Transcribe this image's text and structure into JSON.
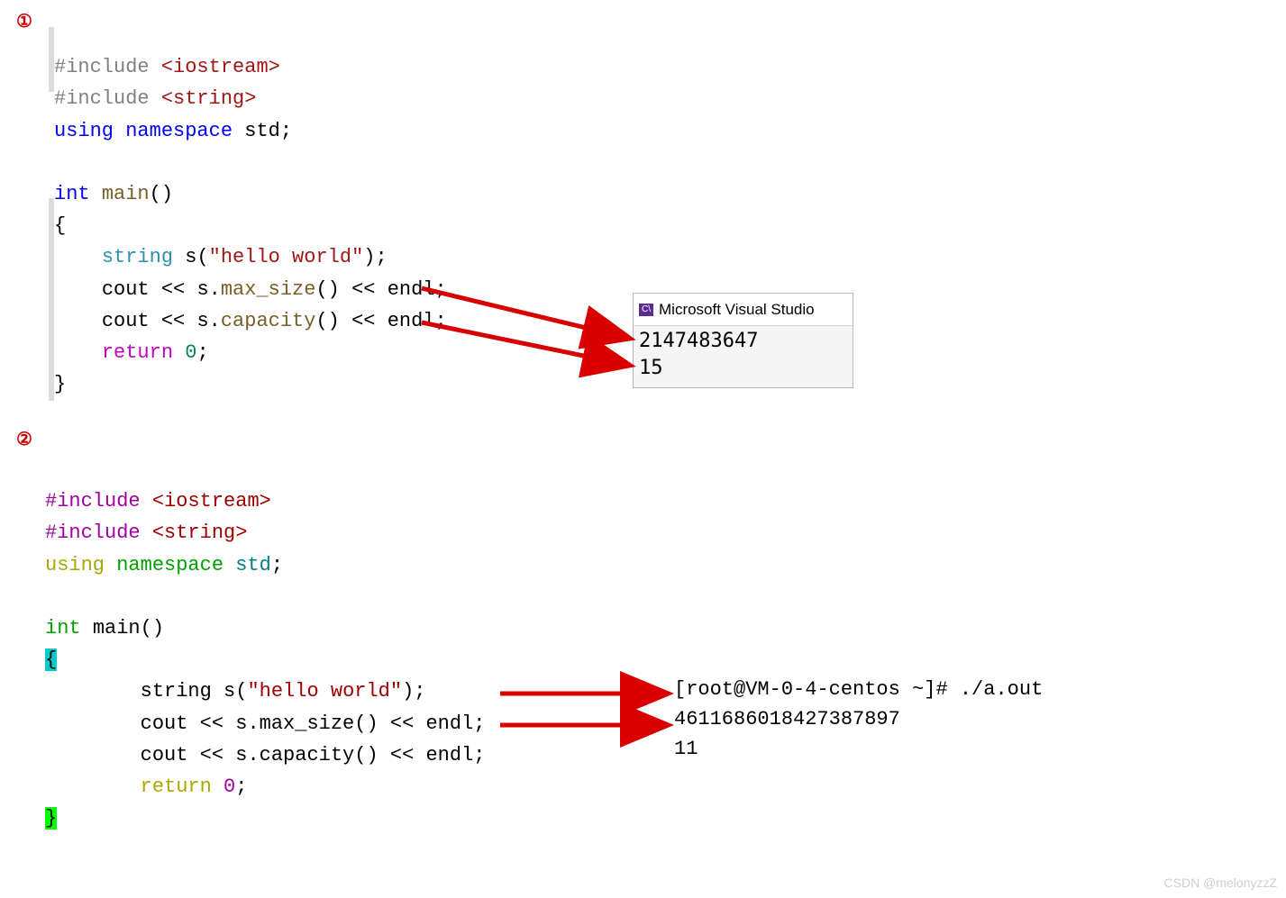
{
  "markers": {
    "one": "①",
    "two": "②"
  },
  "vs_code": {
    "l1_pre": "#include ",
    "l1_inc": "<iostream>",
    "l2_pre": "#include ",
    "l2_inc": "<string>",
    "l3_using": "using ",
    "l3_ns": "namespace ",
    "l3_std": "std",
    "l3_semi": ";",
    "l5_int": "int ",
    "l5_main": "main",
    "l5_par": "()",
    "l6_brace": "{",
    "l7_indent": "    ",
    "l7_string": "string ",
    "l7_s": "s",
    "l7_open": "(",
    "l7_lit": "\"hello world\"",
    "l7_close": ");",
    "l8_indent": "    ",
    "l8_cout": "cout ",
    "l8_op1": "<< ",
    "l8_s": "s",
    "l8_dot": ".",
    "l8_call": "max_size",
    "l8_paren": "() ",
    "l8_op2": "<< ",
    "l8_endl": "endl",
    "l8_semi": ";",
    "l9_indent": "    ",
    "l9_cout": "cout ",
    "l9_op1": "<< ",
    "l9_s": "s",
    "l9_dot": ".",
    "l9_call": "capacity",
    "l9_paren": "() ",
    "l9_op2": "<< ",
    "l9_endl": "endl",
    "l9_semi": ";",
    "l10_indent": "    ",
    "l10_ret": "return ",
    "l10_zero": "0",
    "l10_semi": ";",
    "l11_brace": "}"
  },
  "vs_popup": {
    "title": "Microsoft Visual Studio",
    "line1": "2147483647",
    "line2": "15"
  },
  "gcc_code": {
    "l1_pre": "#include ",
    "l1_inc": "<iostream>",
    "l2_pre": "#include ",
    "l2_inc": "<string>",
    "l3_using": "using ",
    "l3_ns": "namespace ",
    "l3_std": "std",
    "l3_semi": ";",
    "l5_int": "int ",
    "l5_main": "main()",
    "l6_brace": "{",
    "l7_indent": "        ",
    "l7_txt1": "string s(",
    "l7_str": "\"hello world\"",
    "l7_txt2": ");",
    "l8_indent": "        ",
    "l8_txt": "cout << s.max_size() << endl;",
    "l9_indent": "        ",
    "l9_txt": "cout << s.capacity() << endl;",
    "l10_indent": "        ",
    "l10_ret": "return ",
    "l10_zero": "0",
    "l10_semi": ";",
    "l11_brace": "}"
  },
  "terminal": {
    "prompt": "[root@VM-0-4-centos ~]# ./a.out",
    "line1": "4611686018427387897",
    "line2": "11"
  },
  "watermark": "CSDN @melonyzzZ"
}
